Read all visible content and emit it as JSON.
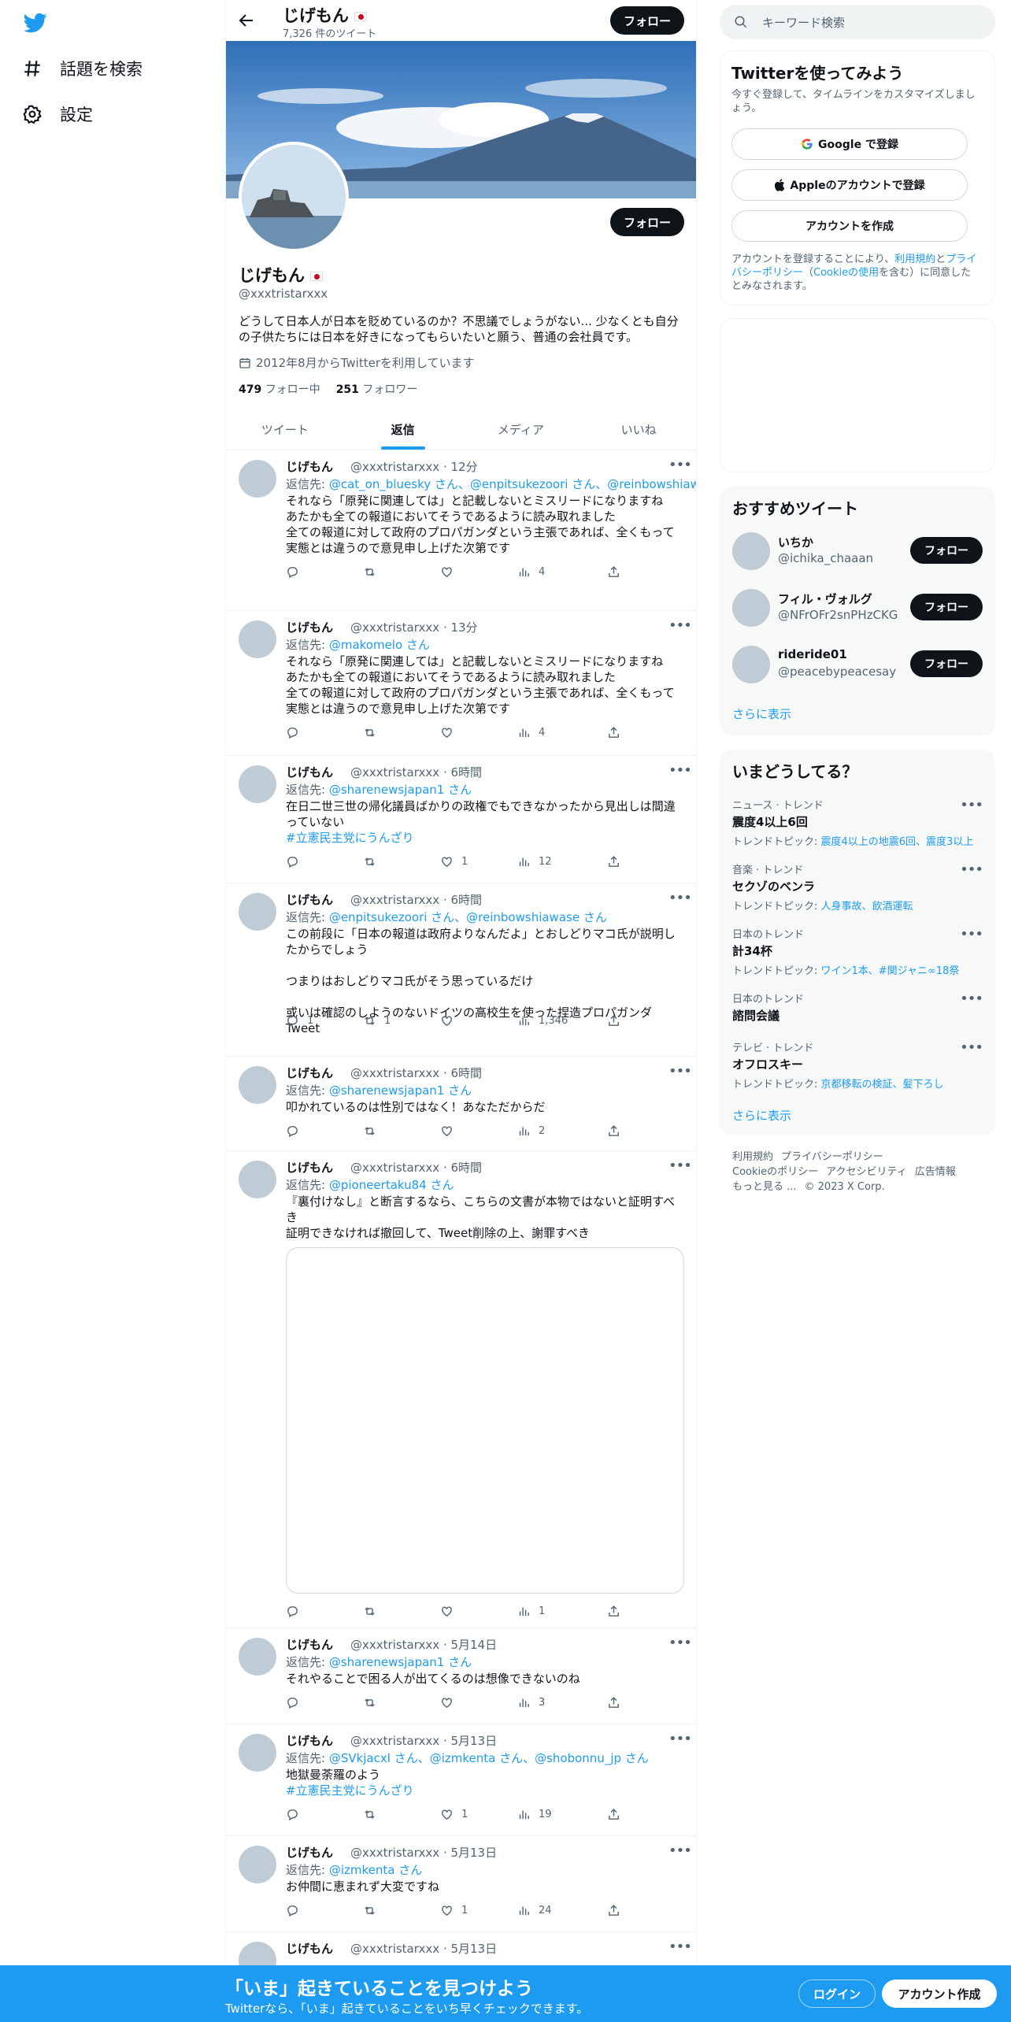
{
  "nav": {
    "explore_label": "話題を検索",
    "settings_label": "設定"
  },
  "header": {
    "name": "じげもん",
    "tweet_count": "7,326 件のツイート",
    "follow_label": "フォロー"
  },
  "profile": {
    "name": "じげもん",
    "handle": "@xxxtristarxxx",
    "follow_label": "フォロー",
    "bio": "どうして日本人が日本を貶めているのか？不思議でしょうがない... 少なくとも自分の子供たちには日本を好きになってもらいたいと願う、普通の会社員です。",
    "joined": "2012年8月からTwitterを利用しています",
    "following_count": "479",
    "following_label": "フォロー中",
    "followers_count": "251",
    "followers_label": "フォロワー"
  },
  "tabs": [
    {
      "label": "ツイート"
    },
    {
      "label": "返信"
    },
    {
      "label": "メディア"
    },
    {
      "label": "いいね"
    }
  ],
  "tweets": [
    {
      "name": "じげもん",
      "handle": "@xxxtristarxxx",
      "time": "· 12分",
      "reply_prefix": "返信先: ",
      "reply_to": "@cat_on_bluesky さん、@enpitsukezoori さん、@reinbowshiawase さん",
      "text": "それなら「原発に関連しては」と記載しないとミスリードになりますね\nあたかも全ての報道においてそうであるように読み取れました\n全ての報道に対して政府のプロパガンダという主張であれば、全くもって\n実態とは違うので意見申し上げた次第です",
      "hashtag": "",
      "replies": "",
      "retweets": "",
      "likes": "",
      "views": "4"
    },
    {
      "name": "じげもん",
      "handle": "@xxxtristarxxx",
      "time": "· 13分",
      "reply_prefix": "返信先: ",
      "reply_to": "@makomelo さん",
      "text": "それなら「原発に関連しては」と記載しないとミスリードになりますね\nあたかも全ての報道においてそうであるように読み取れました\n全ての報道に対して政府のプロパガンダという主張であれば、全くもって\n実態とは違うので意見申し上げた次第です",
      "hashtag": "",
      "replies": "",
      "retweets": "",
      "likes": "",
      "views": "4"
    },
    {
      "name": "じげもん",
      "handle": "@xxxtristarxxx",
      "time": "· 6時間",
      "reply_prefix": "返信先: ",
      "reply_to": "@sharenewsjapan1 さん",
      "text": "在日二世三世の帰化議員ばかりの政権でもできなかったから見出しは間違\nっていない",
      "hashtag": "#立憲民主党にうんざり",
      "replies": "",
      "retweets": "",
      "likes": "1",
      "views": "12"
    },
    {
      "name": "じげもん",
      "handle": "@xxxtristarxxx",
      "time": "· 6時間",
      "reply_prefix": "返信先: ",
      "reply_to": "@enpitsukezoori さん、@reinbowshiawase さん",
      "text": "この前段に「日本の報道は政府よりなんだよ」とおしどりマコ氏が説明し\nたからでしょう\n\nつまりはおしどりマコ氏がそう思っているだけ\n\n或いは確認のしようのないドイツの高校生を使った捏造プロパガンダTweet",
      "hashtag": "",
      "replies": "1",
      "retweets": "1",
      "likes": "",
      "views": "1,346"
    },
    {
      "name": "じげもん",
      "handle": "@xxxtristarxxx",
      "time": "· 6時間",
      "reply_prefix": "返信先: ",
      "reply_to": "@sharenewsjapan1 さん",
      "text": "叩かれているのは性別ではなく！あなただからだ",
      "hashtag": "",
      "replies": "",
      "retweets": "",
      "likes": "",
      "views": "2"
    },
    {
      "name": "じげもん",
      "handle": "@xxxtristarxxx",
      "time": "· 6時間",
      "reply_prefix": "返信先: ",
      "reply_to": "@pioneertaku84 さん",
      "text": "『裏付けなし』と断言するなら、こちらの文書が本物ではないと証明すべ\nき\n証明できなければ撤回して、Tweet削除の上、謝罪すべき",
      "hashtag": "",
      "replies": "",
      "retweets": "",
      "likes": "",
      "views": "1"
    },
    {
      "name": "じげもん",
      "handle": "@xxxtristarxxx",
      "time": "· 5月14日",
      "reply_prefix": "返信先: ",
      "reply_to": "@sharenewsjapan1 さん",
      "text": "それやることで困る人が出てくるのは想像できないのね",
      "hashtag": "",
      "replies": "",
      "retweets": "",
      "likes": "",
      "views": "3"
    },
    {
      "name": "じげもん",
      "handle": "@xxxtristarxxx",
      "time": "· 5月13日",
      "reply_prefix": "返信先: ",
      "reply_to": "@SVkjacxl さん、@izmkenta さん、@shobonnu_jp さん",
      "text": "地獄曼荼羅のよう",
      "hashtag": "#立憲民主党にうんざり",
      "replies": "",
      "retweets": "",
      "likes": "1",
      "views": "19"
    },
    {
      "name": "じげもん",
      "handle": "@xxxtristarxxx",
      "time": "· 5月13日",
      "reply_prefix": "返信先: ",
      "reply_to": "@izmkenta さん",
      "text": "お仲間に恵まれず大変ですね",
      "hashtag": "",
      "replies": "",
      "retweets": "",
      "likes": "1",
      "views": "24"
    },
    {
      "name": "じげもん",
      "handle": "@xxxtristarxxx",
      "time": "· 5月13日",
      "reply_prefix": "",
      "reply_to": "",
      "text": "",
      "hashtag": "",
      "replies": "",
      "retweets": "",
      "likes": "",
      "views": ""
    }
  ],
  "search": {
    "placeholder": "キーワード検索"
  },
  "signup": {
    "title": "Twitterを使ってみよう",
    "subtitle": "今すぐ登録して、タイムラインをカスタマイズしましょう。",
    "google_label": "Google で登録",
    "apple_label": "Appleのアカウントで登録",
    "create_label": "アカウントを作成",
    "terms_prefix": "アカウントを登録することにより、",
    "terms_link": "利用規約",
    "terms_mid": "と",
    "privacy_link": "プライバシーポリシー",
    "cookie_text": "（",
    "cookie_link": "Cookieの使用",
    "terms_suffix": "を含む）に同意したとみなされます。"
  },
  "recommended": {
    "title": "おすすめツイート",
    "items": [
      {
        "name": "いちか",
        "handle": "@ichika_chaaan",
        "follow": "フォロー"
      },
      {
        "name": "フィル・ヴォルグ",
        "handle": "@NFrOFr2snPHzCKG",
        "follow": "フォロー"
      },
      {
        "name": "rideride01",
        "handle": "@peacebypeacesay",
        "follow": "フォロー"
      }
    ],
    "more_label": "さらに表示"
  },
  "trends": {
    "title": "いまどうしてる？",
    "items": [
      {
        "context": "ニュース · トレンド",
        "title": "震度4以上6回",
        "topics_prefix": "トレンドトピック: ",
        "topics": "震度4以上の地震6回、震度3以上"
      },
      {
        "context": "音楽 · トレンド",
        "title": "セクゾのベンラ",
        "topics_prefix": "トレンドトピック: ",
        "topics": "人身事故、飲酒運転"
      },
      {
        "context": "日本のトレンド",
        "title": "計34杯",
        "topics_prefix": "トレンドトピック: ",
        "topics": "ワイン1本、#関ジャニ∞18祭"
      },
      {
        "context": "日本のトレンド",
        "title": "諮問会議",
        "topics_prefix": "",
        "topics": ""
      },
      {
        "context": "テレビ · トレンド",
        "title": "オフロスキー",
        "topics_prefix": "トレンドトピック: ",
        "topics": "京都移転の検証、髪下ろし"
      }
    ],
    "more_label": "さらに表示"
  },
  "footer": {
    "terms": "利用規約",
    "privacy": "プライバシーポリシー",
    "cookie": "Cookieのポリシー",
    "accessibility": "アクセシビリティ",
    "ads": "広告情報",
    "more": "もっと見る ...",
    "copyright": "© 2023 X Corp."
  },
  "bottombar": {
    "title": "「いま」起きていることを見つけよう",
    "subtitle": "Twitterなら、「いま」起きていることをいち早くチェックできます。",
    "login_label": "ログイン",
    "create_label": "アカウント作成"
  },
  "colors": {
    "accent": "#1d9bf0",
    "text": "#0f1419",
    "muted": "#536471"
  }
}
